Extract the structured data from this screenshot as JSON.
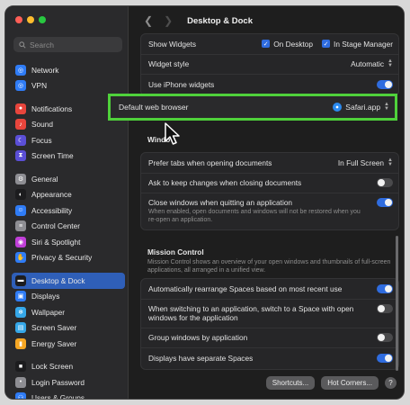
{
  "window": {
    "title": "Desktop & Dock"
  },
  "search": {
    "placeholder": "Search"
  },
  "sidebar": {
    "items": [
      {
        "label": "Network",
        "icon": "globe-icon",
        "color": "#2f7cf6"
      },
      {
        "label": "VPN",
        "icon": "globe-icon",
        "color": "#2f7cf6"
      },
      {
        "label": "Notifications",
        "icon": "bell-icon",
        "color": "#e8453c"
      },
      {
        "label": "Sound",
        "icon": "speaker-icon",
        "color": "#e8453c"
      },
      {
        "label": "Focus",
        "icon": "moon-icon",
        "color": "#5b4fd6"
      },
      {
        "label": "Screen Time",
        "icon": "hourglass-icon",
        "color": "#5b4fd6"
      },
      {
        "label": "General",
        "icon": "gear-icon",
        "color": "#8e8e93"
      },
      {
        "label": "Appearance",
        "icon": "appearance-icon",
        "color": "#1c1c1e"
      },
      {
        "label": "Accessibility",
        "icon": "accessibility-icon",
        "color": "#2f7cf6"
      },
      {
        "label": "Control Center",
        "icon": "control-center-icon",
        "color": "#8e8e93"
      },
      {
        "label": "Siri & Spotlight",
        "icon": "siri-icon",
        "color": "#c03fd8"
      },
      {
        "label": "Privacy & Security",
        "icon": "hand-icon",
        "color": "#2f7cf6"
      },
      {
        "label": "Desktop & Dock",
        "icon": "dock-icon",
        "color": "#1c1c1e"
      },
      {
        "label": "Displays",
        "icon": "display-icon",
        "color": "#2f7cf6"
      },
      {
        "label": "Wallpaper",
        "icon": "wallpaper-icon",
        "color": "#35a7e8"
      },
      {
        "label": "Screen Saver",
        "icon": "screensaver-icon",
        "color": "#35a7e8"
      },
      {
        "label": "Energy Saver",
        "icon": "battery-icon",
        "color": "#f5a623"
      },
      {
        "label": "Lock Screen",
        "icon": "lock-icon",
        "color": "#1c1c1e"
      },
      {
        "label": "Login Password",
        "icon": "key-icon",
        "color": "#8e8e93"
      },
      {
        "label": "Users & Groups",
        "icon": "users-icon",
        "color": "#2f7cf6"
      }
    ],
    "active_index": 12
  },
  "widgets": {
    "show_widgets_label": "Show Widgets",
    "on_desktop_label": "On Desktop",
    "in_stage_manager_label": "In Stage Manager",
    "widget_style_label": "Widget style",
    "widget_style_value": "Automatic",
    "use_iphone_widgets_label": "Use iPhone widgets",
    "use_iphone_widgets_on": true
  },
  "browser": {
    "label": "Default web browser",
    "value": "Safari.app"
  },
  "windows": {
    "section_title_partial": "Windo",
    "prefer_tabs_label": "Prefer tabs when opening documents",
    "prefer_tabs_value": "In Full Screen",
    "ask_keep_changes_label": "Ask to keep changes when closing documents",
    "ask_keep_changes_on": false,
    "close_windows_label": "Close windows when quitting an application",
    "close_windows_desc": "When enabled, open documents and windows will not be restored when you re-open an application.",
    "close_windows_on": true
  },
  "mission_control": {
    "title": "Mission Control",
    "desc": "Mission Control shows an overview of your open windows and thumbnails of full-screen applications, all arranged in a unified view.",
    "auto_rearrange_label": "Automatically rearrange Spaces based on most recent use",
    "auto_rearrange_on": true,
    "switch_space_label": "When switching to an application, switch to a Space with open windows for the application",
    "switch_space_on": false,
    "group_windows_label": "Group windows by application",
    "group_windows_on": false,
    "separate_spaces_label": "Displays have separate Spaces",
    "separate_spaces_on": true
  },
  "buttons": {
    "shortcuts": "Shortcuts...",
    "hot_corners": "Hot Corners...",
    "help": "?"
  },
  "colors": {
    "accent": "#2f6cdf",
    "highlight_border": "#4fd13b",
    "sidebar_active": "#2f5fb8"
  }
}
